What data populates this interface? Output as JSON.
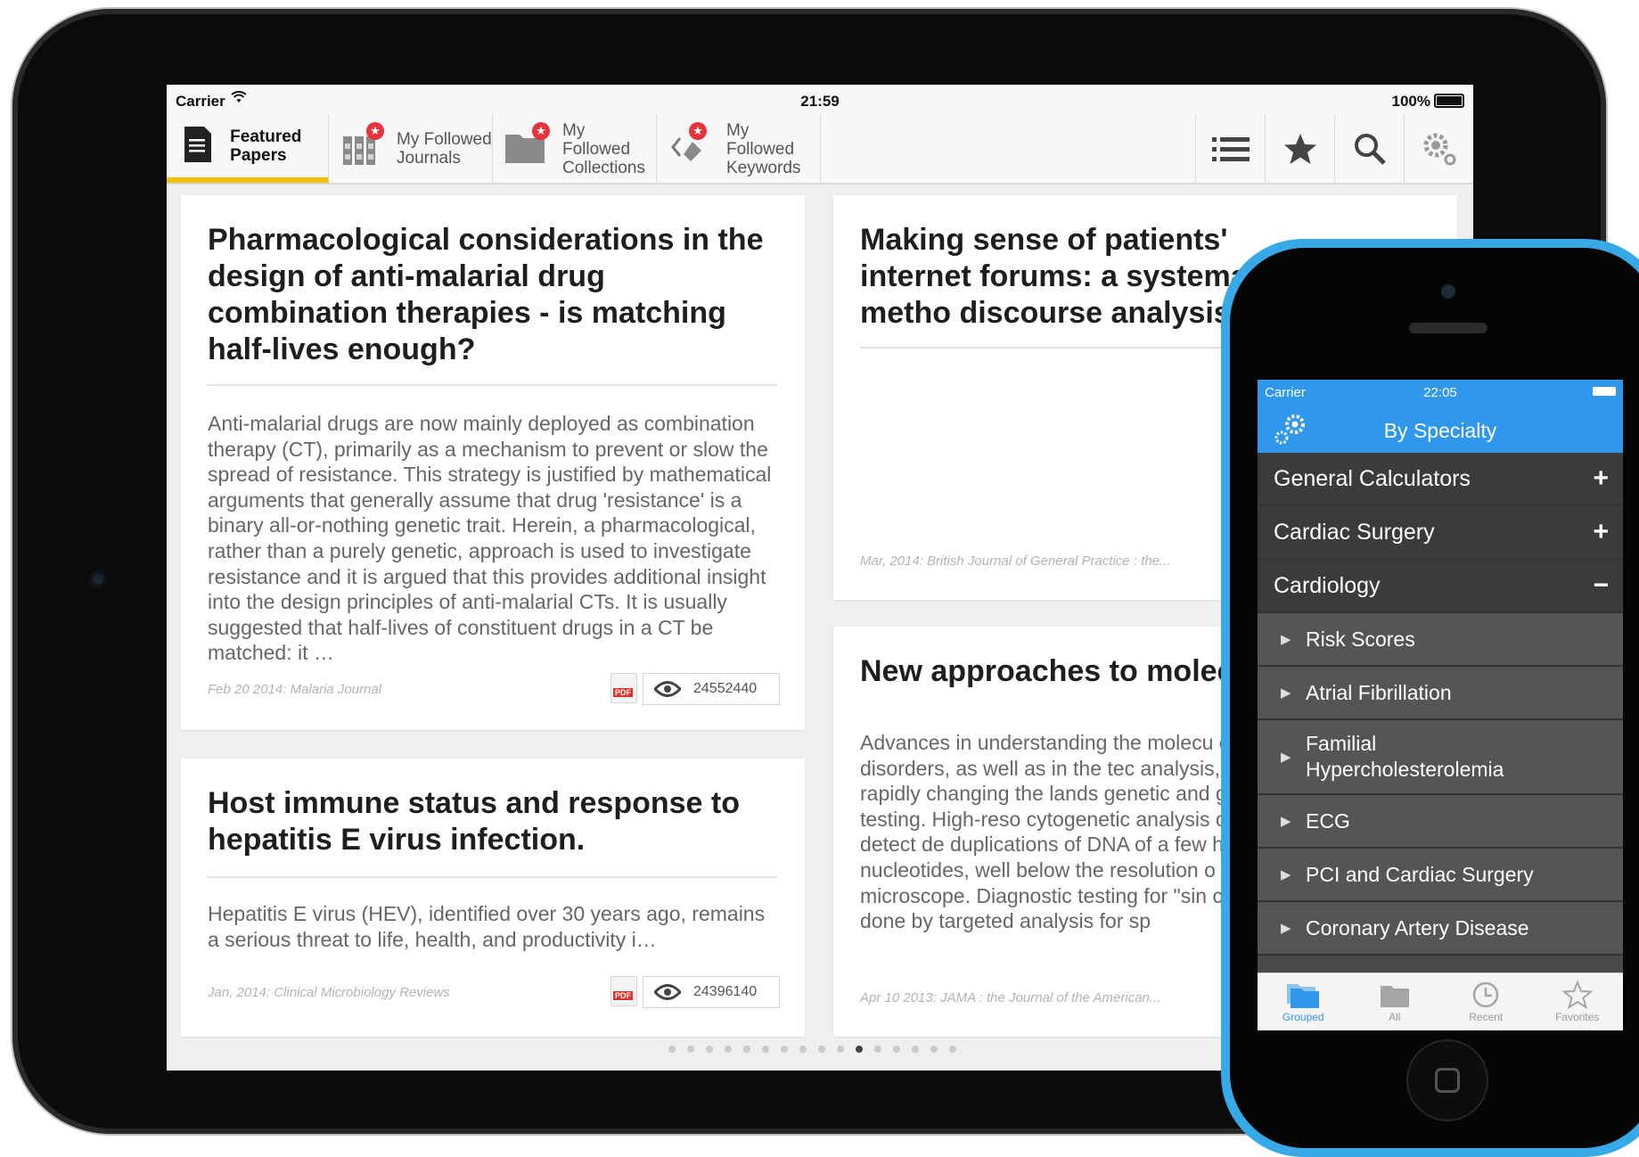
{
  "ipad": {
    "status": {
      "carrier": "Carrier",
      "time": "21:59",
      "battery": "100%"
    },
    "tabs": [
      {
        "label_line1": "Featured",
        "label_line2": "Papers",
        "active": true,
        "icon": "document-icon"
      },
      {
        "label_line1": "My Followed",
        "label_line2": "Journals",
        "active": false,
        "icon": "journals-icon"
      },
      {
        "label_line1": "My Followed",
        "label_line2": "Collections",
        "active": false,
        "icon": "folder-icon"
      },
      {
        "label_line1": "My Followed",
        "label_line2": "Keywords",
        "active": false,
        "icon": "tag-icon"
      }
    ],
    "toolbar_icons": [
      "list-icon",
      "star-icon",
      "search-icon",
      "gear-icon"
    ],
    "cards": [
      {
        "title": "Pharmacological considerations in the design of anti-malarial drug combination therapies - is matching half-lives enough?",
        "abstract": "Anti-malarial drugs are now mainly deployed as combination therapy (CT), primarily as a mechanism to prevent or slow the spread of resistance. This strategy is justified by mathematical arguments that generally assume that drug 'resistance' is a binary all-or-nothing genetic trait. Herein, a pharmacological, rather than a purely genetic, approach is used to investigate resistance and it is argued that this provides additional insight into the design principles of anti-malarial CTs. It is usually suggested that half-lives of constituent drugs in a CT be matched: it …",
        "source": "Feb 20 2014: Malaria Journal",
        "views": "24552440"
      },
      {
        "title": "Host immune status and response to hepatitis E virus infection.",
        "abstract": "Hepatitis E virus (HEV), identified over 30 years ago, remains a serious threat to life, health, and productivity i…",
        "source": "Jan, 2014: Clinical Microbiology Reviews",
        "views": "24396140"
      },
      {
        "title": "Making sense of patients' internet forums: a systematic metho discourse analysis.",
        "abstract": "",
        "source": "Mar, 2014: British Journal of General Practice : the..."
      },
      {
        "title": "New approaches to molecu",
        "abstract": "Advances in understanding the molecu common disorders, as well as in the tec analysis, are rapidly changing the lands genetic and genomic testing. High-reso cytogenetic analysis can now detect de duplications of DNA of a few hundred t nucleotides, well below the resolution o microscope. Diagnostic testing for \"sin can be done by targeted analysis for sp",
        "source": "Apr 10 2013: JAMA : the Journal of the American..."
      }
    ],
    "pdf_label": "PDF",
    "page_count": 16,
    "current_page": 11
  },
  "iphone": {
    "status": {
      "carrier": "Carrier",
      "time": "22:05"
    },
    "nav_title": "By Specialty",
    "rows": [
      {
        "label": "General Calculators",
        "kind": "category",
        "sign": "+"
      },
      {
        "label": "Cardiac Surgery",
        "kind": "category",
        "sign": "+"
      },
      {
        "label": "Cardiology",
        "kind": "category",
        "sign": "−"
      },
      {
        "label": "Risk Scores",
        "kind": "sub"
      },
      {
        "label": "Atrial Fibrillation",
        "kind": "sub"
      },
      {
        "label": "Familial Hypercholesterolemia",
        "kind": "sub"
      },
      {
        "label": "ECG",
        "kind": "sub"
      },
      {
        "label": "PCI and Cardiac Surgery",
        "kind": "sub"
      },
      {
        "label": "Coronary Artery Disease",
        "kind": "sub"
      }
    ],
    "tabbar": [
      {
        "label": "Grouped",
        "icon": "grouped-icon",
        "active": true
      },
      {
        "label": "All",
        "icon": "folder-icon",
        "active": false
      },
      {
        "label": "Recent",
        "icon": "clock-icon",
        "active": false
      },
      {
        "label": "Favorites",
        "icon": "star-outline-icon",
        "active": false
      }
    ]
  },
  "colors": {
    "accent_yellow": "#f2c200",
    "ios_blue": "#2f97ec",
    "iphone_shell": "#37a9e6",
    "badge_red": "#e8323c"
  }
}
